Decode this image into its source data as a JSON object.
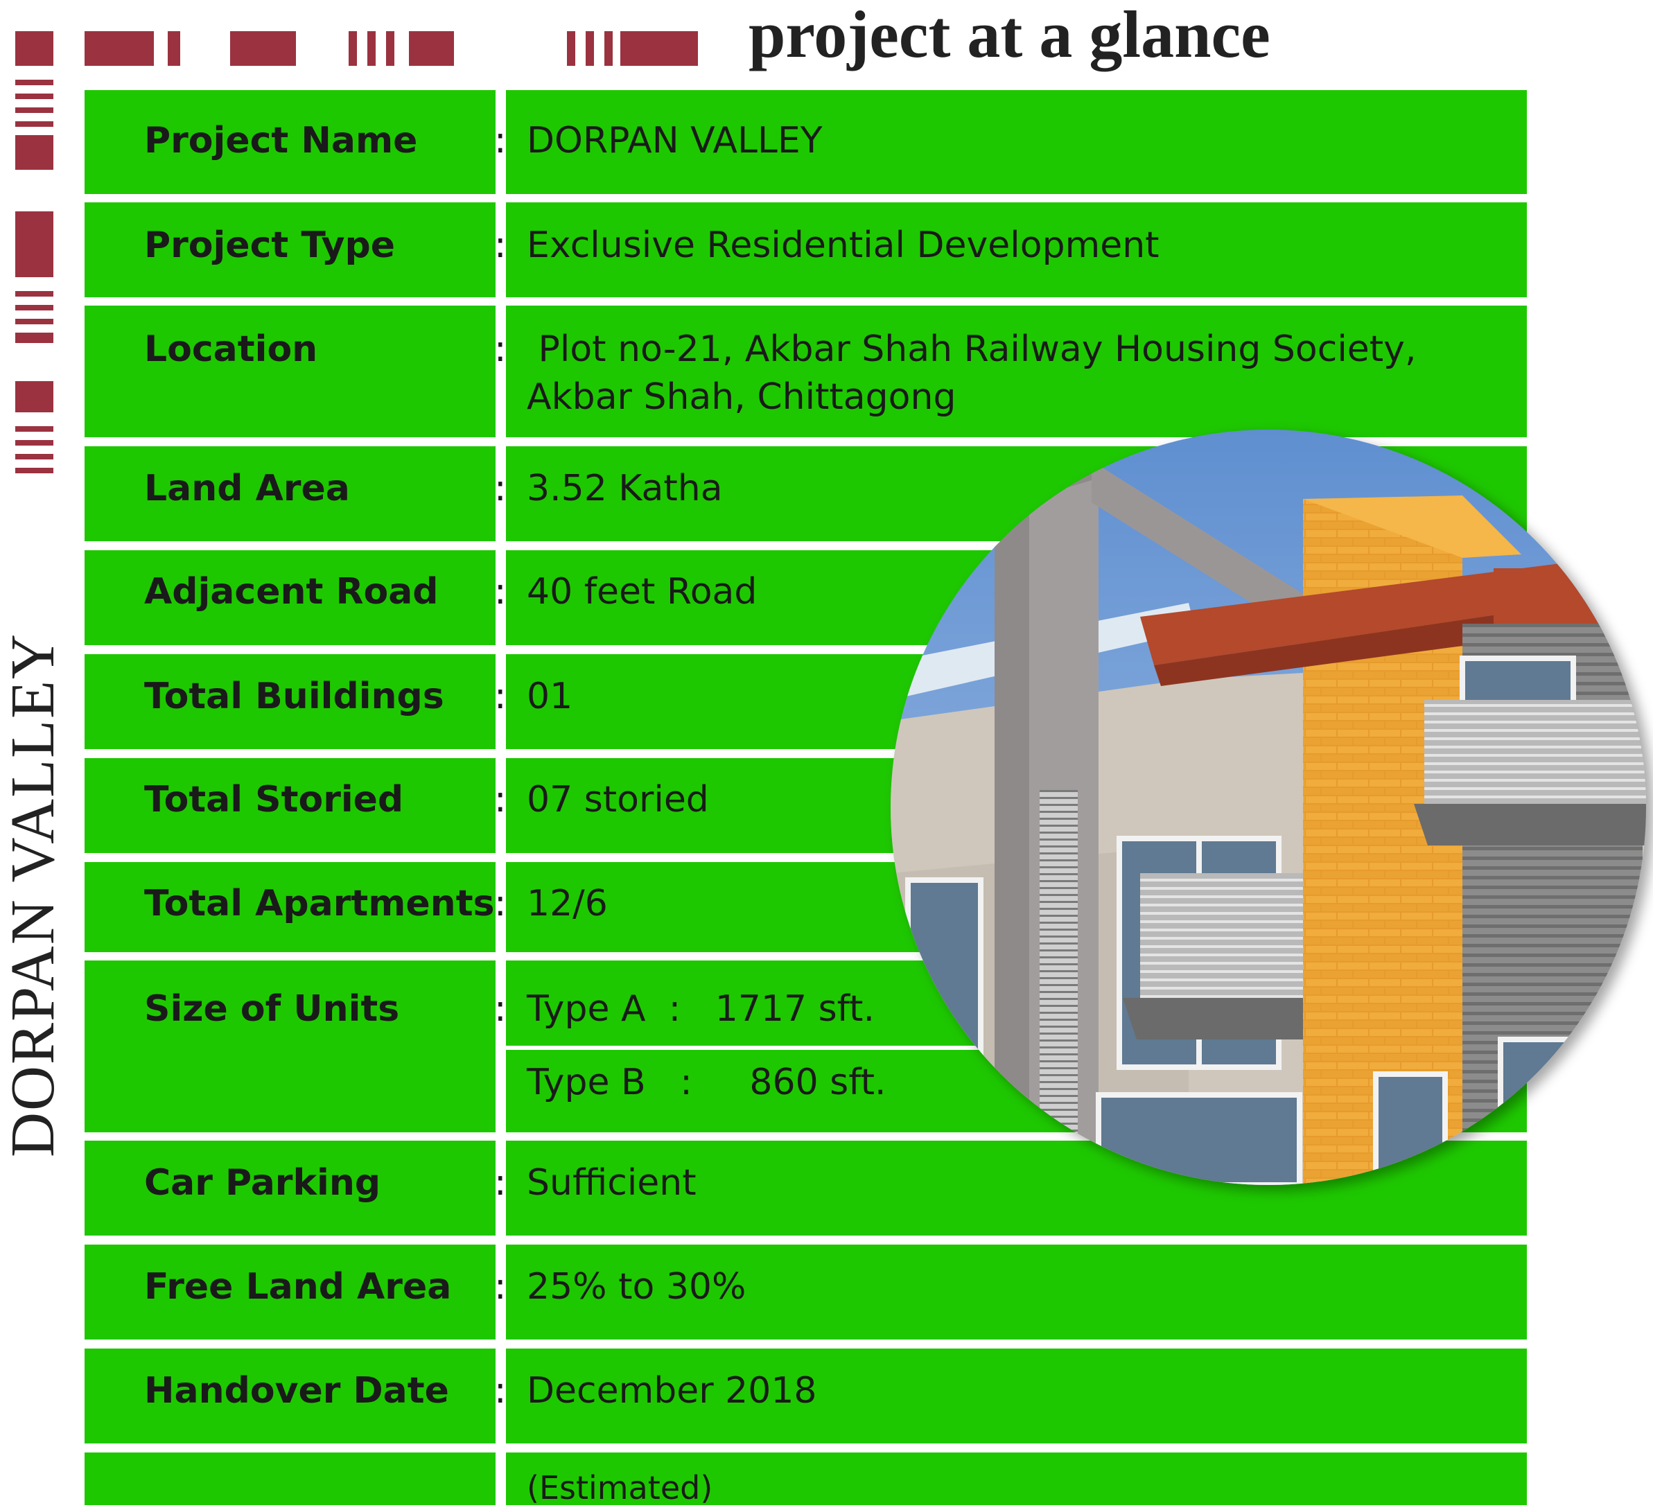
{
  "title": "project at a glance",
  "brand": "DORPAN VALLEY",
  "details": [
    {
      "label": "Project Name",
      "value": "DORPAN VALLEY"
    },
    {
      "label": "Project Type",
      "value": "Exclusive Residential Development"
    },
    {
      "label": "Location",
      "value": " Plot no-21, Akbar Shah Railway Housing Society,",
      "value2": "Akbar Shah, Chittagong"
    },
    {
      "label": "Land Area",
      "value": "3.52 Katha"
    },
    {
      "label": "Adjacent Road",
      "value": "40 feet Road"
    },
    {
      "label": "Total Buildings",
      "value": "01"
    },
    {
      "label": "Total Storied",
      "value": "07 storied"
    },
    {
      "label": "Total Apartments",
      "value": "12/6"
    },
    {
      "label": "Size of Units",
      "value": "Type A  :   1717 sft.",
      "value2": "Type B   :     860 sft."
    },
    {
      "label": "Car Parking",
      "value": "Sufficient"
    },
    {
      "label": "Free Land Area",
      "value": "25% to 30%"
    },
    {
      "label": "Handover Date",
      "value": "December 2018",
      "value2": "(Estimated)"
    }
  ],
  "separator": ":",
  "colors": {
    "row": "#1ec800",
    "accent": "#9b3240",
    "text": "#1a1a1a"
  },
  "photo": {
    "kind": "building facade rendering"
  }
}
